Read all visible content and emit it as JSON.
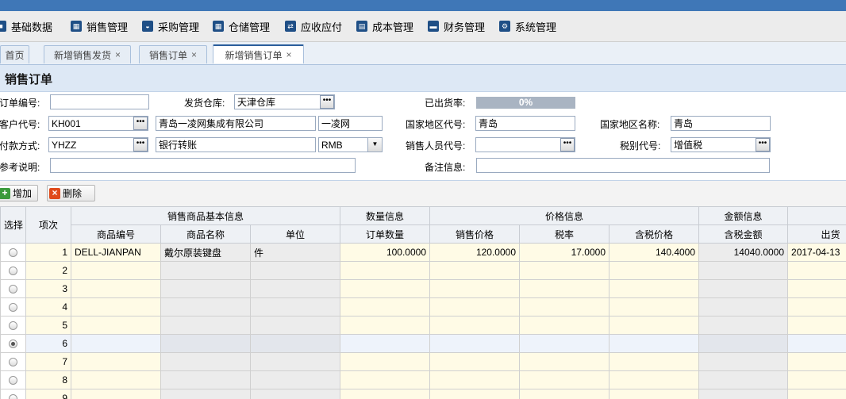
{
  "menu": [
    {
      "label": "基础数据",
      "icon": "cube-icon",
      "glyph": "■"
    },
    {
      "label": "销售管理",
      "icon": "calendar-icon",
      "glyph": "▦"
    },
    {
      "label": "采购管理",
      "icon": "basket-icon",
      "glyph": "◒"
    },
    {
      "label": "仓储管理",
      "icon": "calendar-icon",
      "glyph": "▦"
    },
    {
      "label": "应收应付",
      "icon": "exchange-icon",
      "glyph": "⇄"
    },
    {
      "label": "成本管理",
      "icon": "book-icon",
      "glyph": "▤"
    },
    {
      "label": "财务管理",
      "icon": "money-icon",
      "glyph": "▬"
    },
    {
      "label": "系统管理",
      "icon": "gear-icon",
      "glyph": "⚙"
    }
  ],
  "tabs": [
    {
      "label": "首页",
      "closable": false
    },
    {
      "label": "新增销售发货",
      "closable": true
    },
    {
      "label": "销售订单",
      "closable": true
    },
    {
      "label": "新增销售订单",
      "closable": true,
      "active": true
    }
  ],
  "page_title": "销售订单",
  "form": {
    "order_no_label": "订单编号:",
    "order_no": "",
    "warehouse_label": "发货仓库:",
    "warehouse": "天津仓库",
    "shipped_rate_label": "已出货率:",
    "shipped_rate": "0%",
    "shipped_rate_value": 0,
    "customer_code_label": "客户代号:",
    "customer_code": "KH001",
    "customer_name": "青岛一凌网集成有限公司",
    "customer_short": "一凌网",
    "region_code_label": "国家地区代号:",
    "region_code": "青岛",
    "region_name_label": "国家地区名称:",
    "region_name": "青岛",
    "payment_label": "付款方式:",
    "payment_code": "YHZZ",
    "payment_name": "银行转账",
    "currency": "RMB",
    "salesperson_label": "销售人员代号:",
    "salesperson": "",
    "tax_code_label": "税别代号:",
    "tax_code": "增值税",
    "reference_label": "参考说明:",
    "reference": "",
    "remark_label": "备注信息:",
    "remark": ""
  },
  "toolbar": {
    "add_label": "增加",
    "delete_label": "删除"
  },
  "grid": {
    "group_headers": {
      "select": "选择",
      "index": "项次",
      "basic": "销售商品基本信息",
      "quantity": "数量信息",
      "price": "价格信息",
      "amount": "金额信息"
    },
    "columns": {
      "code": "商品编号",
      "name": "商品名称",
      "unit": "单位",
      "qty": "订单数量",
      "price": "销售价格",
      "tax": "税率",
      "tax_price": "含税价格",
      "tax_amount": "含税金额",
      "ship_date": "出货"
    },
    "rows": [
      {
        "idx": "1",
        "code": "DELL-JIANPAN",
        "name": "戴尔原装键盘",
        "unit": "件",
        "qty": "100.0000",
        "price": "120.0000",
        "tax": "17.0000",
        "tax_price": "140.4000",
        "tax_amount": "14040.0000",
        "ship_date": "2017-04-13",
        "selected": false
      },
      {
        "idx": "2",
        "code": "",
        "name": "",
        "unit": "",
        "qty": "",
        "price": "",
        "tax": "",
        "tax_price": "",
        "tax_amount": "",
        "ship_date": "",
        "selected": false
      },
      {
        "idx": "3",
        "code": "",
        "name": "",
        "unit": "",
        "qty": "",
        "price": "",
        "tax": "",
        "tax_price": "",
        "tax_amount": "",
        "ship_date": "",
        "selected": false
      },
      {
        "idx": "4",
        "code": "",
        "name": "",
        "unit": "",
        "qty": "",
        "price": "",
        "tax": "",
        "tax_price": "",
        "tax_amount": "",
        "ship_date": "",
        "selected": false
      },
      {
        "idx": "5",
        "code": "",
        "name": "",
        "unit": "",
        "qty": "",
        "price": "",
        "tax": "",
        "tax_price": "",
        "tax_amount": "",
        "ship_date": "",
        "selected": false
      },
      {
        "idx": "6",
        "code": "",
        "name": "",
        "unit": "",
        "qty": "",
        "price": "",
        "tax": "",
        "tax_price": "",
        "tax_amount": "",
        "ship_date": "",
        "selected": true
      },
      {
        "idx": "7",
        "code": "",
        "name": "",
        "unit": "",
        "qty": "",
        "price": "",
        "tax": "",
        "tax_price": "",
        "tax_amount": "",
        "ship_date": "",
        "selected": false
      },
      {
        "idx": "8",
        "code": "",
        "name": "",
        "unit": "",
        "qty": "",
        "price": "",
        "tax": "",
        "tax_price": "",
        "tax_amount": "",
        "ship_date": "",
        "selected": false
      },
      {
        "idx": "9",
        "code": "",
        "name": "",
        "unit": "",
        "qty": "",
        "price": "",
        "tax": "",
        "tax_price": "",
        "tax_amount": "",
        "ship_date": "",
        "selected": false
      }
    ]
  }
}
